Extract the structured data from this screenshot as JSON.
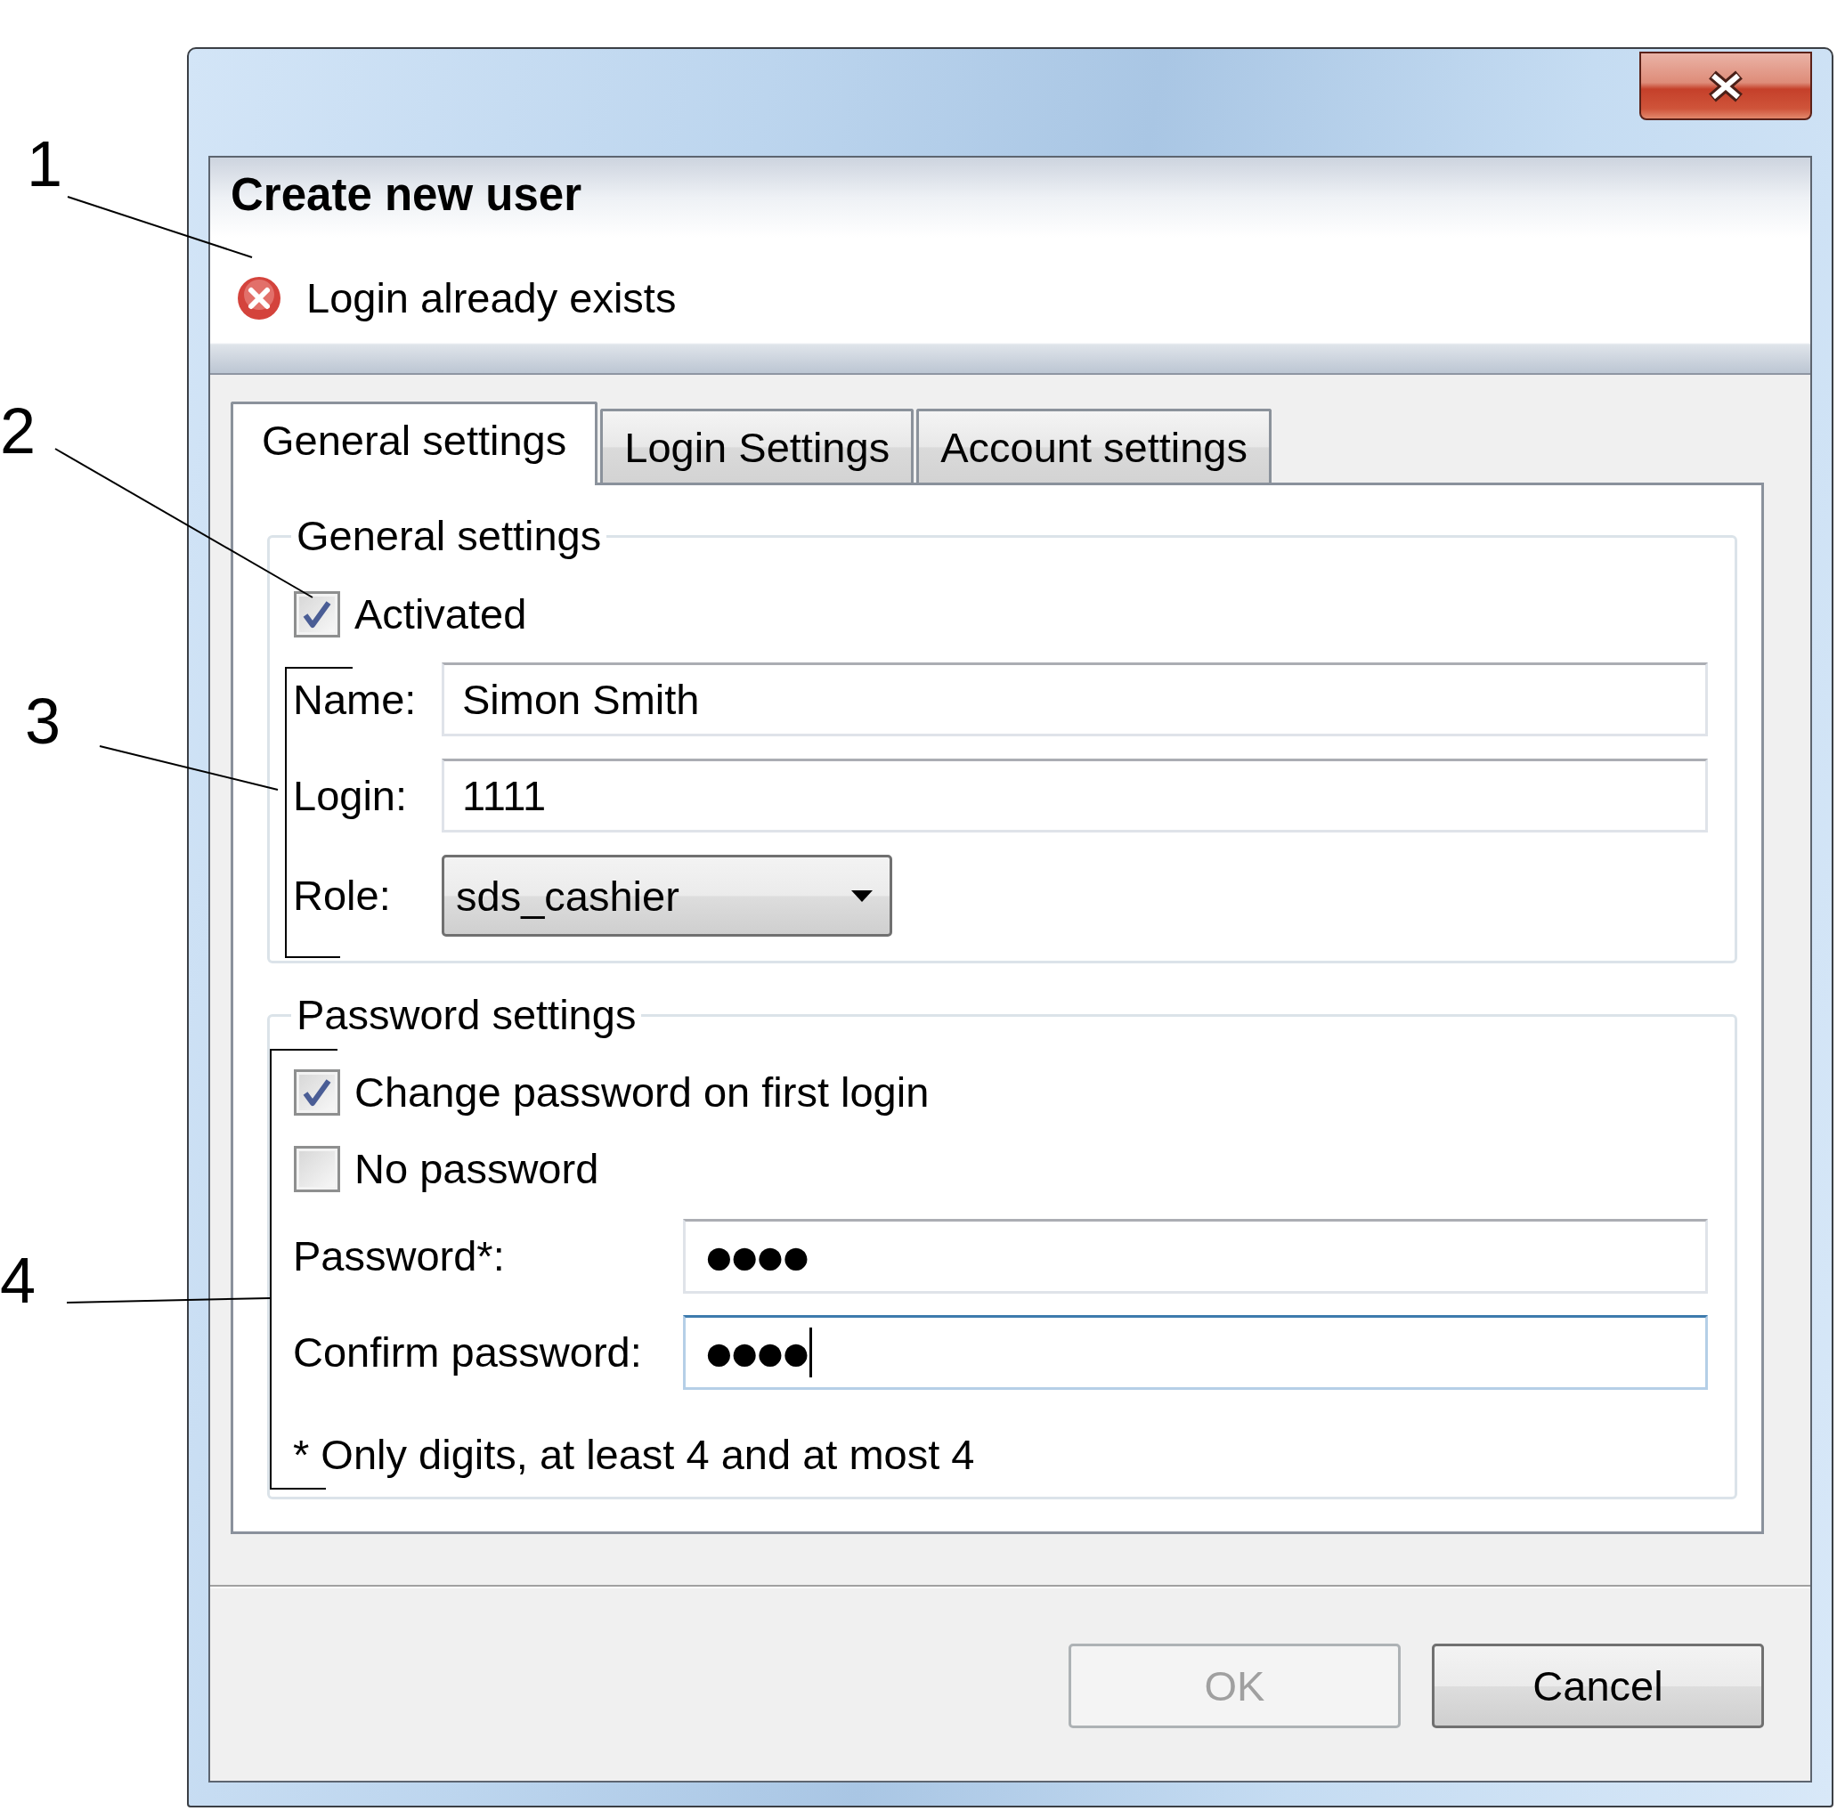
{
  "callouts": [
    {
      "label": "1"
    },
    {
      "label": "2"
    },
    {
      "label": "3"
    },
    {
      "label": "4"
    }
  ],
  "header": {
    "title": "Create new user",
    "message": {
      "kind": "error",
      "text": "Login already exists"
    }
  },
  "tabs": [
    {
      "label": "General settings",
      "selected": true
    },
    {
      "label": "Login Settings",
      "selected": false
    },
    {
      "label": "Account settings",
      "selected": false
    }
  ],
  "general_settings": {
    "legend": "General settings",
    "activated": {
      "label": "Activated",
      "checked": true
    },
    "fields": [
      {
        "kind": "text",
        "label": "Name:",
        "value": "Simon Smith"
      },
      {
        "kind": "text",
        "label": "Login:",
        "value": "1111"
      },
      {
        "kind": "dropdown",
        "label": "Role:",
        "value": "sds_cashier"
      }
    ]
  },
  "password_settings": {
    "legend": "Password settings",
    "options": [
      {
        "label": "Change password on first login",
        "checked": true
      },
      {
        "label": "No password",
        "checked": false
      }
    ],
    "fields": [
      {
        "label": "Password*:",
        "value": "●●●●",
        "focused": false
      },
      {
        "label": "Confirm password:",
        "value": "●●●●",
        "focused": true
      }
    ],
    "note": "* Only digits, at least 4 and at most 4"
  },
  "buttons": [
    {
      "label": "OK",
      "disabled": true
    },
    {
      "label": "Cancel",
      "disabled": false
    }
  ]
}
